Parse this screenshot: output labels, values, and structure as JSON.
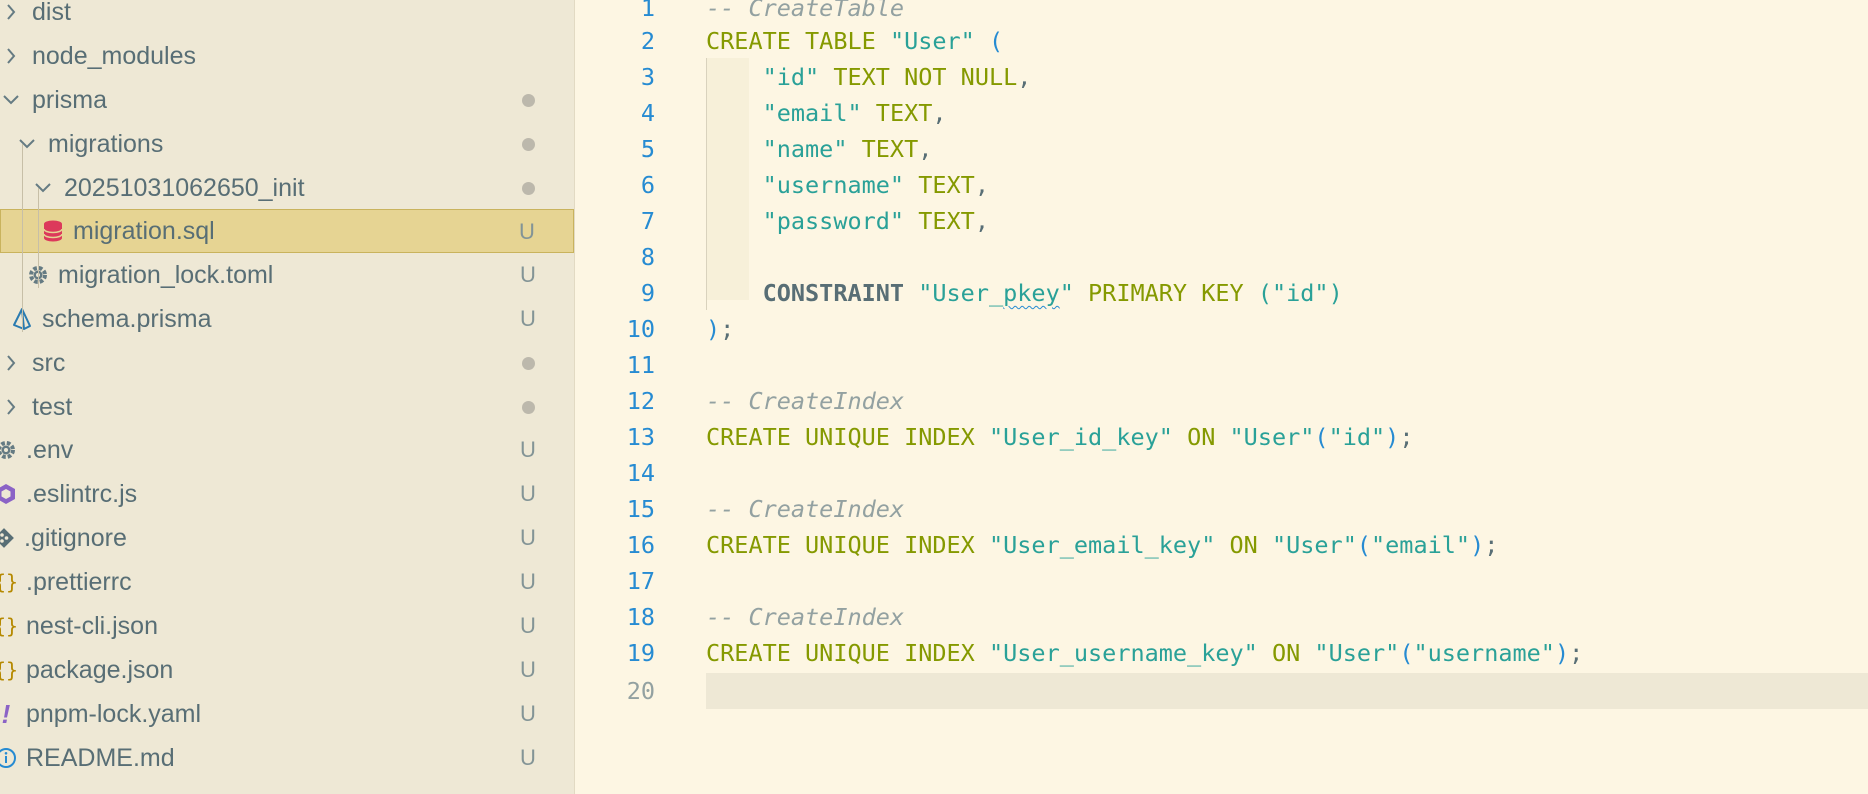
{
  "explorer": {
    "items": [
      {
        "label": "dist",
        "kind": "folder",
        "expanded": false,
        "decoration": ""
      },
      {
        "label": "node_modules",
        "kind": "folder",
        "expanded": false,
        "decoration": ""
      },
      {
        "label": "prisma",
        "kind": "folder",
        "expanded": true,
        "decoration": "dot"
      },
      {
        "label": "migrations",
        "kind": "folder",
        "expanded": true,
        "decoration": "dot"
      },
      {
        "label": "20251031062650_init",
        "kind": "folder",
        "expanded": true,
        "decoration": "dot"
      },
      {
        "label": "migration.sql",
        "kind": "file",
        "icon": "database-icon",
        "decoration": "U",
        "selected": true
      },
      {
        "label": "migration_lock.toml",
        "kind": "file",
        "icon": "gear-icon",
        "decoration": "U"
      },
      {
        "label": "schema.prisma",
        "kind": "file",
        "icon": "prisma-icon",
        "decoration": "U"
      },
      {
        "label": "src",
        "kind": "folder",
        "expanded": false,
        "decoration": "dot"
      },
      {
        "label": "test",
        "kind": "folder",
        "expanded": false,
        "decoration": "dot"
      },
      {
        "label": ".env",
        "kind": "file",
        "icon": "gear-icon",
        "decoration": "U"
      },
      {
        "label": ".eslintrc.js",
        "kind": "file",
        "icon": "eslint-icon",
        "decoration": "U"
      },
      {
        "label": ".gitignore",
        "kind": "file",
        "icon": "git-icon",
        "decoration": "U"
      },
      {
        "label": ".prettierrc",
        "kind": "file",
        "icon": "json-braces-icon",
        "decoration": "U"
      },
      {
        "label": "nest-cli.json",
        "kind": "file",
        "icon": "json-braces-icon",
        "decoration": "U"
      },
      {
        "label": "package.json",
        "kind": "file",
        "icon": "json-braces-icon",
        "decoration": "U"
      },
      {
        "label": "pnpm-lock.yaml",
        "kind": "file",
        "icon": "exclamation-icon",
        "decoration": "U"
      },
      {
        "label": "README.md",
        "kind": "file",
        "icon": "info-icon",
        "decoration": "U"
      }
    ]
  },
  "editor": {
    "lines": [
      {
        "n": "1",
        "text": "-- CreateTable"
      },
      {
        "n": "2",
        "text": "CREATE TABLE \"User\" ("
      },
      {
        "n": "3",
        "text": "    \"id\" TEXT NOT NULL,"
      },
      {
        "n": "4",
        "text": "    \"email\" TEXT,"
      },
      {
        "n": "5",
        "text": "    \"name\" TEXT,"
      },
      {
        "n": "6",
        "text": "    \"username\" TEXT,"
      },
      {
        "n": "7",
        "text": "    \"password\" TEXT,"
      },
      {
        "n": "8",
        "text": ""
      },
      {
        "n": "9",
        "text": "    CONSTRAINT \"User_pkey\" PRIMARY KEY (\"id\")"
      },
      {
        "n": "10",
        "text": ");"
      },
      {
        "n": "11",
        "text": ""
      },
      {
        "n": "12",
        "text": "-- CreateIndex"
      },
      {
        "n": "13",
        "text": "CREATE UNIQUE INDEX \"User_id_key\" ON \"User\"(\"id\");"
      },
      {
        "n": "14",
        "text": ""
      },
      {
        "n": "15",
        "text": "-- CreateIndex"
      },
      {
        "n": "16",
        "text": "CREATE UNIQUE INDEX \"User_email_key\" ON \"User\"(\"email\");"
      },
      {
        "n": "17",
        "text": ""
      },
      {
        "n": "18",
        "text": "-- CreateIndex"
      },
      {
        "n": "19",
        "text": "CREATE UNIQUE INDEX \"User_username_key\" ON \"User\"(\"username\");"
      },
      {
        "n": "20",
        "text": ""
      }
    ]
  },
  "colors": {
    "sidebar_bg": "#eee8d5",
    "editor_bg": "#fdf6e3",
    "selection": "#e6d493",
    "keyword": "#859900",
    "string": "#2aa198",
    "comment": "#93a1a1",
    "punctuation": "#268bd2"
  }
}
